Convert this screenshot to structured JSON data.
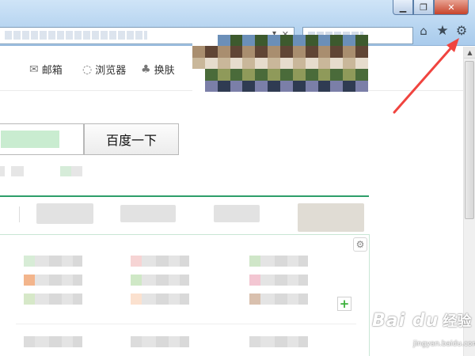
{
  "window": {
    "minimize_label": "▁",
    "restore_label": "❐",
    "close_label": "✕"
  },
  "toolbar": {
    "address_dropdown": "▾",
    "address_close": "✕",
    "home_icon": "⌂",
    "star_icon": "★",
    "gear_icon": "⚙"
  },
  "header": {
    "nav": [
      {
        "label": "邮箱",
        "icon": "mail-icon",
        "glyph": "✉"
      },
      {
        "label": "浏览器",
        "icon": "browser-icon",
        "glyph": "◌"
      },
      {
        "label": "换肤",
        "icon": "skin-icon",
        "glyph": "♣"
      }
    ]
  },
  "search": {
    "button_label": "百度一下"
  },
  "panel": {
    "gear_glyph": "⚙",
    "add_glyph": "+"
  },
  "scrollbar": {
    "up_arrow": "▲"
  },
  "annotation": {
    "color": "#f0443f"
  },
  "watermark": {
    "logo": "Bai du",
    "subtitle": "经验",
    "url": "jingyan.baidu.com"
  },
  "colors": {
    "accent_green": "#2e9e6a",
    "add_green": "#3bb03b"
  }
}
